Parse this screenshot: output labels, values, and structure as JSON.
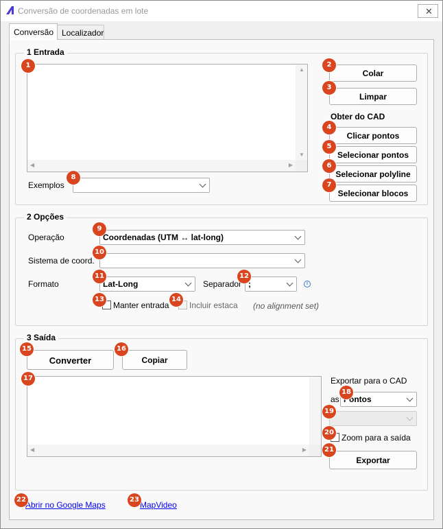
{
  "window": {
    "title": "Conversão de coordenadas em lote",
    "close_glyph": "✕"
  },
  "tabs": [
    {
      "label": "Conversão"
    },
    {
      "label": "Localizador"
    }
  ],
  "entrada": {
    "group_label": "1  Entrada",
    "colar": "Colar",
    "limpar": "Limpar",
    "obter_label": "Obter do CAD",
    "clicar_pontos": "Clicar pontos",
    "selecionar_pontos": "Selecionar pontos",
    "selecionar_polyline": "Selecionar polyline",
    "selecionar_blocos": "Selecionar blocos",
    "exemplos_label": "Exemplos",
    "exemplos_value": ""
  },
  "opcoes": {
    "group_label": "2  Opções",
    "operacao_label": "Operação",
    "operacao_value": "Coordenadas  (UTM ↔ lat-long)",
    "sistema_label": "Sistema de coord.",
    "sistema_value": "",
    "formato_label": "Formato",
    "formato_value": "Lat-Long",
    "separador_label": "Separador",
    "separador_value": ";",
    "manter_entrada": "Manter entrada",
    "incluir_estaca": "Incluir estaca",
    "no_alignment": "(no alignment set)"
  },
  "saida": {
    "group_label": "3  Saída",
    "converter": "Converter",
    "copiar": "Copiar",
    "exportar_label": "Exportar para o CAD",
    "as_label": "as",
    "as_value": "Pontos",
    "zoom_label": "Zoom para a saída",
    "exportar": "Exportar"
  },
  "links": {
    "google_maps": "Abrir no Google Maps",
    "mapvideo": "MapVideo"
  },
  "markers": [
    "1",
    "2",
    "3",
    "4",
    "5",
    "6",
    "7",
    "8",
    "9",
    "10",
    "11",
    "12",
    "13",
    "14",
    "15",
    "16",
    "17",
    "18",
    "19",
    "20",
    "21",
    "22",
    "23"
  ],
  "colors": {
    "marker": "#d9451e",
    "link": "#0000ee"
  }
}
